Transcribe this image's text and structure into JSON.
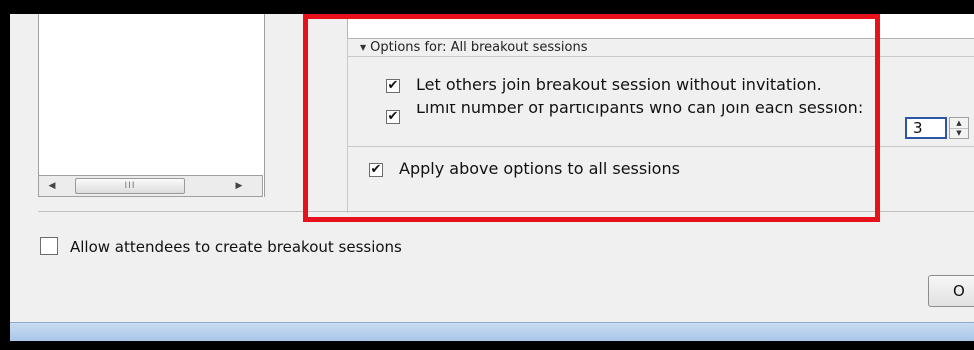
{
  "breakout_options": {
    "header": "Options for: All breakout sessions",
    "let_others_join_label": "Let others join breakout session without invitation.",
    "let_others_join_checked": true,
    "limit_participants_label": "Limit number of participants who can join each session:",
    "limit_participants_checked": true,
    "limit_value": "3",
    "apply_all_label": "Apply above options to all sessions",
    "apply_all_checked": true
  },
  "allow_attendees_label": "Allow attendees to create breakout sessions",
  "allow_attendees_checked": false,
  "ok_button_label": "O",
  "scrollbar": {
    "thumb_grip": "III",
    "left_arrow": "◀",
    "right_arrow": "▶"
  },
  "glyphs": {
    "check": "✔",
    "triangle": "▼",
    "spin_up": "▲",
    "spin_down": "▼"
  },
  "colors": {
    "highlight": "#e8101a",
    "focus_border": "#2e55a6"
  }
}
